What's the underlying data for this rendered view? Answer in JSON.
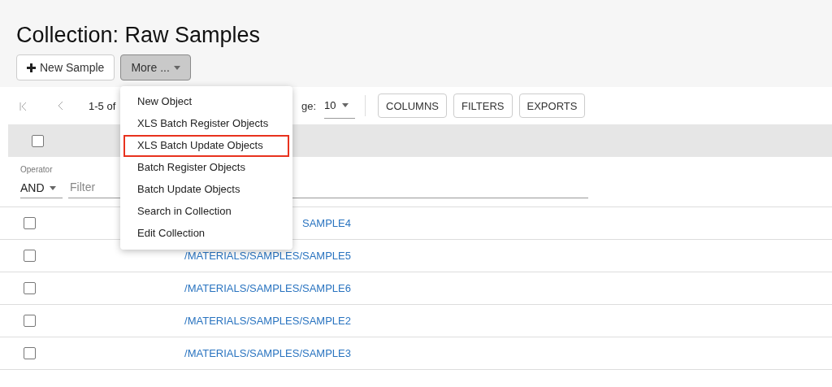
{
  "title": "Collection: Raw Samples",
  "actions": [
    {
      "kind": "new",
      "label": "New Sample",
      "pressed": false
    },
    {
      "kind": "menu",
      "label": "More ...",
      "pressed": true
    }
  ],
  "pagination": {
    "range": "1-5 of",
    "rows_label": "ge:",
    "rows_value": "10"
  },
  "toolbar_buttons": [
    "COLUMNS",
    "FILTERS",
    "EXPORTS"
  ],
  "header": {
    "checked": false
  },
  "filter": {
    "operator_label": "Operator",
    "operator": "AND",
    "placeholder": "Filter"
  },
  "rows": [
    {
      "checked": false,
      "link": "SAMPLE4"
    },
    {
      "checked": false,
      "link": "/MATERIALS/SAMPLES/SAMPLE5"
    },
    {
      "checked": false,
      "link": "/MATERIALS/SAMPLES/SAMPLE6"
    },
    {
      "checked": false,
      "link": "/MATERIALS/SAMPLES/SAMPLE2"
    },
    {
      "checked": false,
      "link": "/MATERIALS/SAMPLES/SAMPLE3"
    }
  ],
  "menu": [
    {
      "label": "New Object",
      "highlighted": false
    },
    {
      "label": "XLS Batch Register Objects",
      "highlighted": false
    },
    {
      "label": "XLS Batch Update Objects",
      "highlighted": true
    },
    {
      "label": "Batch Register Objects",
      "highlighted": false
    },
    {
      "label": "Batch Update Objects",
      "highlighted": false
    },
    {
      "label": "Search in Collection",
      "highlighted": false
    },
    {
      "label": "Edit Collection",
      "highlighted": false
    }
  ]
}
